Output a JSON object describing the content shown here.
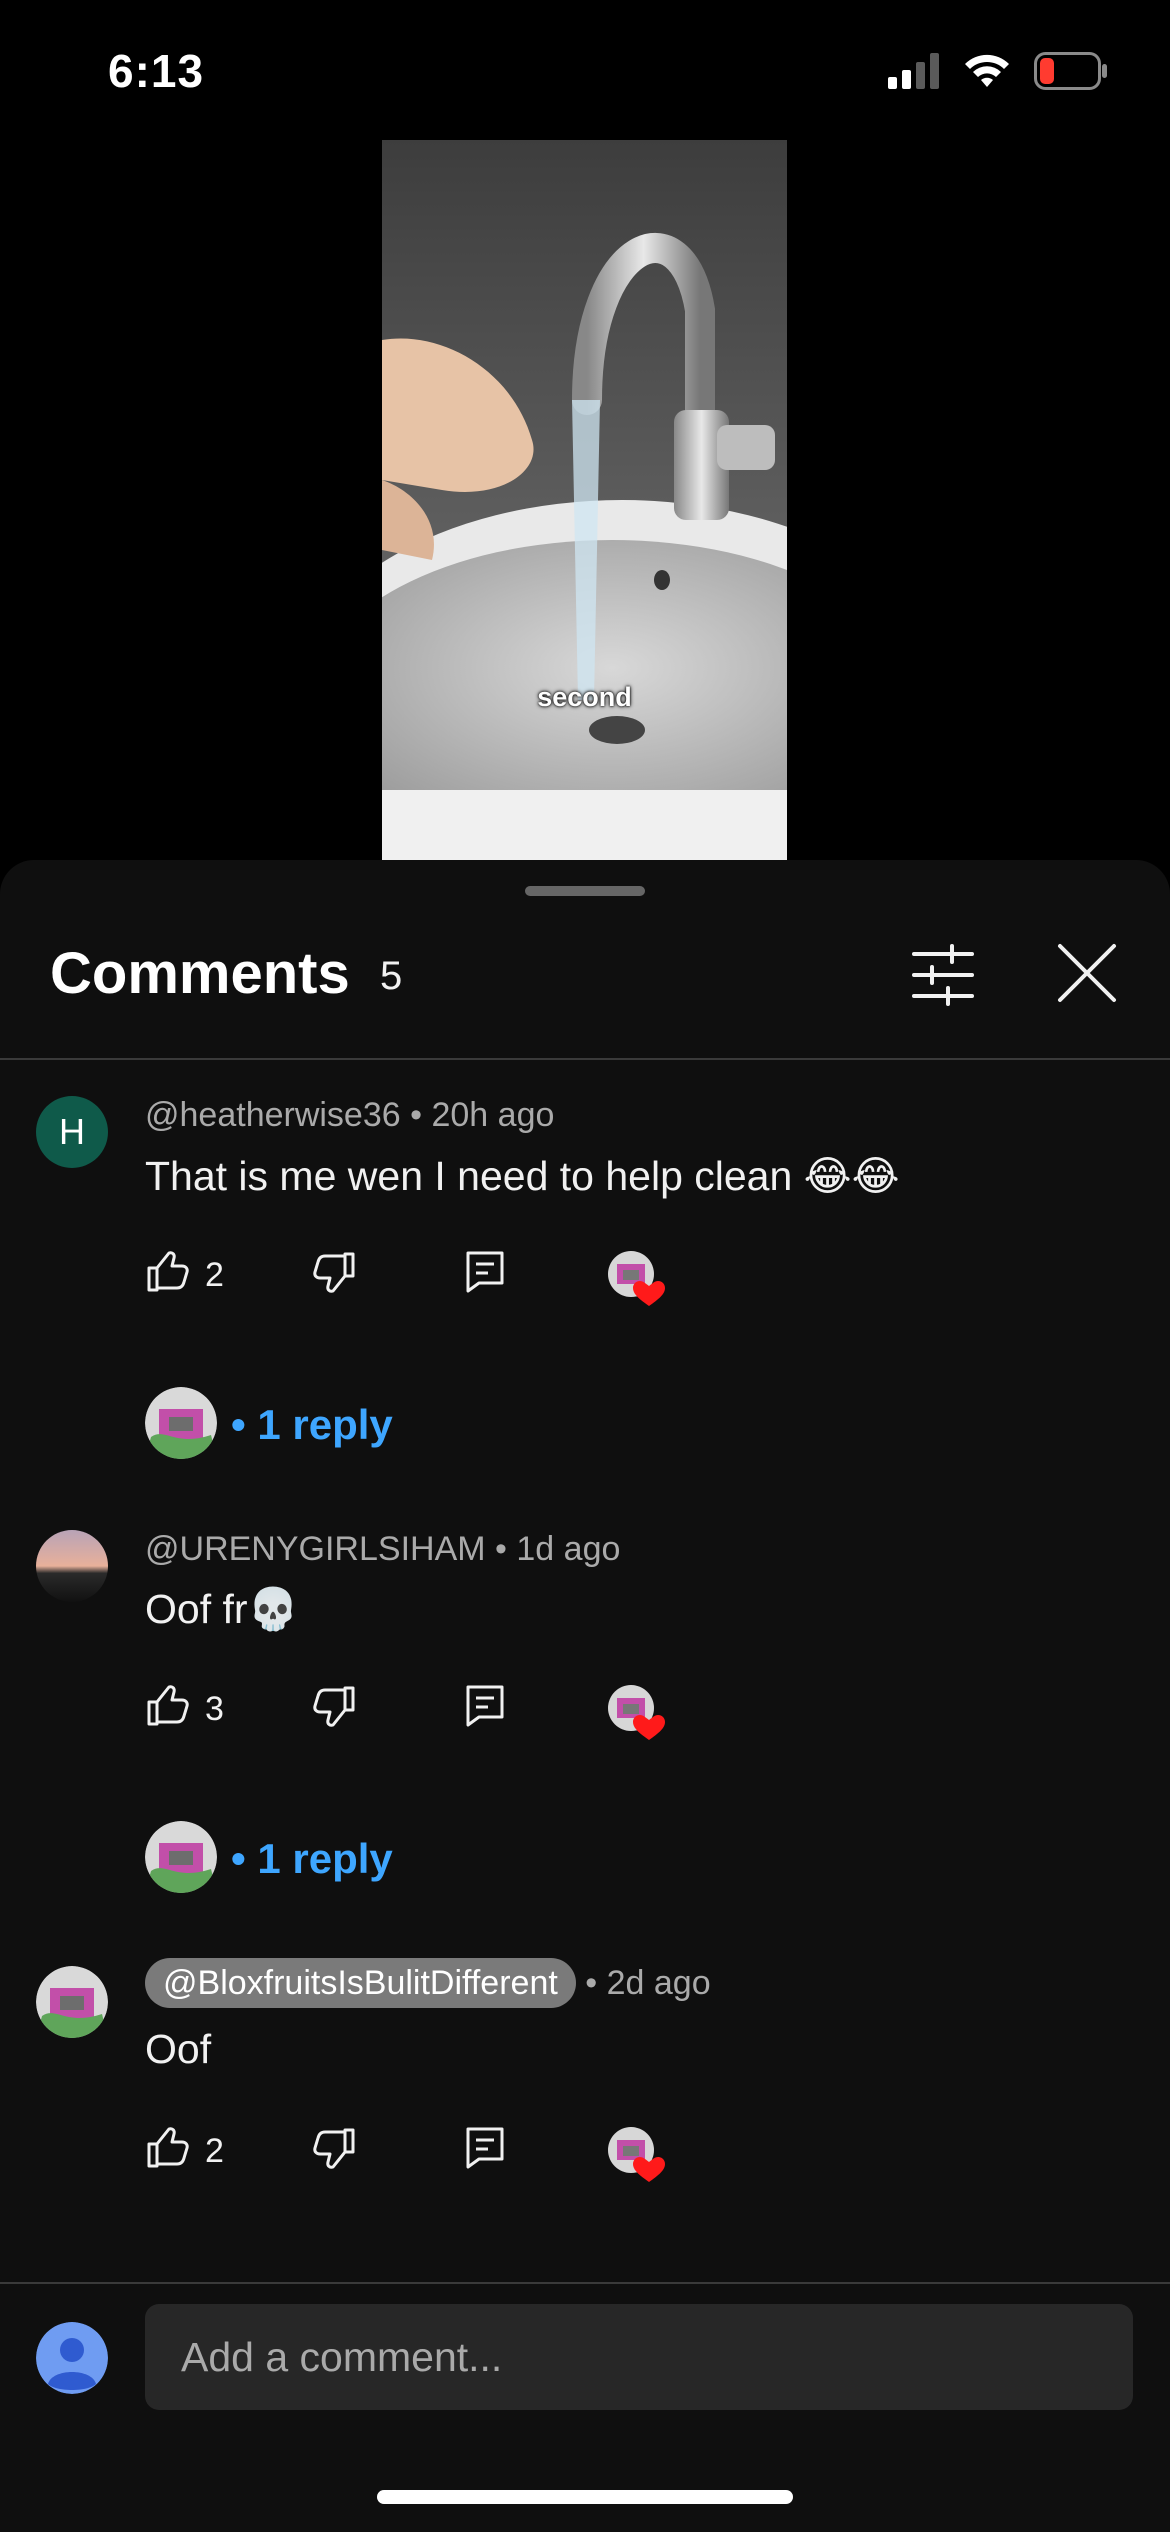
{
  "status_bar": {
    "time": "6:13"
  },
  "video": {
    "caption": "second"
  },
  "comments_panel": {
    "title": "Comments",
    "count": "5",
    "comments": [
      {
        "author": "@heatherwise36",
        "age": "20h ago",
        "text": "That is me wen I need to help clean 😂😂",
        "likes": "2",
        "avatar_letter": "H",
        "avatar_color": "#0f5a4a",
        "replies": "1 reply"
      },
      {
        "author": "@URENYGIRLSIHAM",
        "age": "1d ago",
        "text": "Oof fr💀",
        "likes": "3",
        "replies": "1 reply"
      },
      {
        "author": "@BloxfruitsIsBulitDifferent",
        "age": "2d ago",
        "text": "Oof",
        "likes": "2"
      }
    ],
    "composer": {
      "placeholder": "Add a comment..."
    }
  },
  "icons": [
    "signal-icon",
    "wifi-icon",
    "battery-icon",
    "filter-icon",
    "close-icon",
    "like-icon",
    "dislike-icon",
    "reply-icon",
    "heart-icon",
    "user-icon"
  ],
  "colors": {
    "link": "#3ea6ff",
    "background": "#0f0f0f",
    "heart": "#ff1a1a"
  }
}
